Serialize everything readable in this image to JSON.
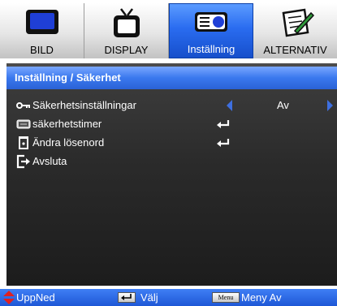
{
  "tabs": [
    {
      "label": "BILD",
      "icon": "monitor-icon",
      "active": false
    },
    {
      "label": "DISPLAY",
      "icon": "tv-icon",
      "active": false
    },
    {
      "label": "Inställning",
      "icon": "projector-icon",
      "active": true
    },
    {
      "label": "ALTERNATIV",
      "icon": "note-pencil-icon",
      "active": false
    }
  ],
  "breadcrumb": "Inställning / Säkerhet",
  "menu": {
    "items": [
      {
        "label": "Säkerhetsinställningar",
        "icon": "key-icon",
        "value": "Av"
      },
      {
        "label": "säkerhetstimer",
        "icon": "timer-icon"
      },
      {
        "label": "Ändra lösenord",
        "icon": "password-icon"
      },
      {
        "label": "Avsluta",
        "icon": "exit-icon"
      }
    ]
  },
  "footer": {
    "nav_label": "UppNed",
    "select_label": "Välj",
    "menu_key": "Menu",
    "menu_label": "Meny Av"
  },
  "colors": {
    "accent_blue": "#2a6cf0",
    "arrow_blue": "#3e6fe0",
    "panel_dark": "#2b2b2b",
    "nav_red": "#e02020"
  }
}
